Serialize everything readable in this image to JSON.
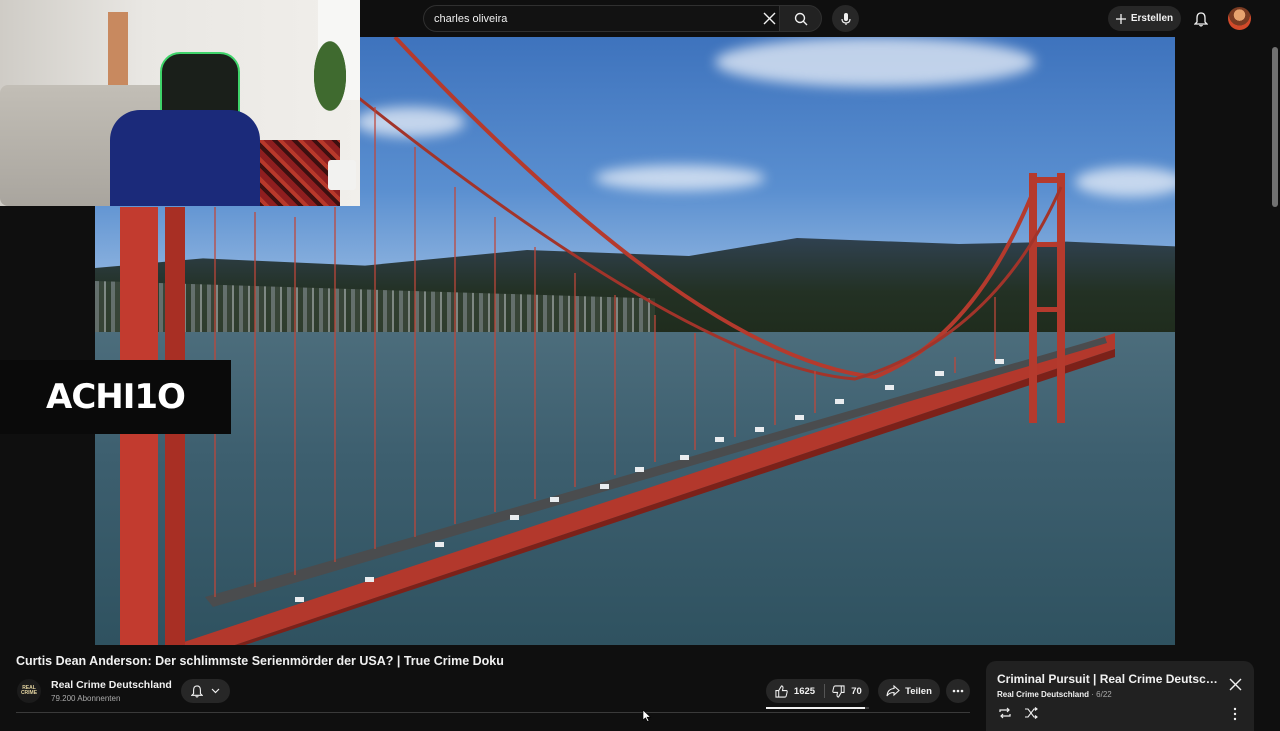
{
  "search": {
    "query": "charles oliveira"
  },
  "header": {
    "create_label": "Erstellen"
  },
  "icons": {
    "search": "search-icon",
    "clear": "close-icon",
    "mic": "microphone-icon",
    "create": "plus-icon",
    "bell": "bell-icon",
    "like": "thumbs-up-icon",
    "dislike": "thumbs-down-icon",
    "share": "share-icon",
    "more": "more-horizontal-icon",
    "loop": "loop-icon",
    "shuffle": "shuffle-icon",
    "more_vertical": "more-vertical-icon"
  },
  "overlay": {
    "badge_text": "ACHI1O"
  },
  "video": {
    "title": "Curtis Dean Anderson: Der schlimmste Serienmörder der USA? | True Crime Doku",
    "channel_name": "Real Crime Deutschland",
    "channel_avatar_text": "REAL CRIME",
    "subscribers": "79.200 Abonnenten",
    "likes": "1625",
    "dislikes": "70",
    "like_ratio": 0.96,
    "share_label": "Teilen"
  },
  "playlist": {
    "title": "Criminal Pursuit | Real Crime Deutschland",
    "channel": "Real Crime Deutschland",
    "separator": "·",
    "position": "6/22"
  },
  "colors": {
    "background": "#0f0f0f",
    "chip": "#272727",
    "bridge": "#c23b2f",
    "badge": "#0a0a0a"
  }
}
